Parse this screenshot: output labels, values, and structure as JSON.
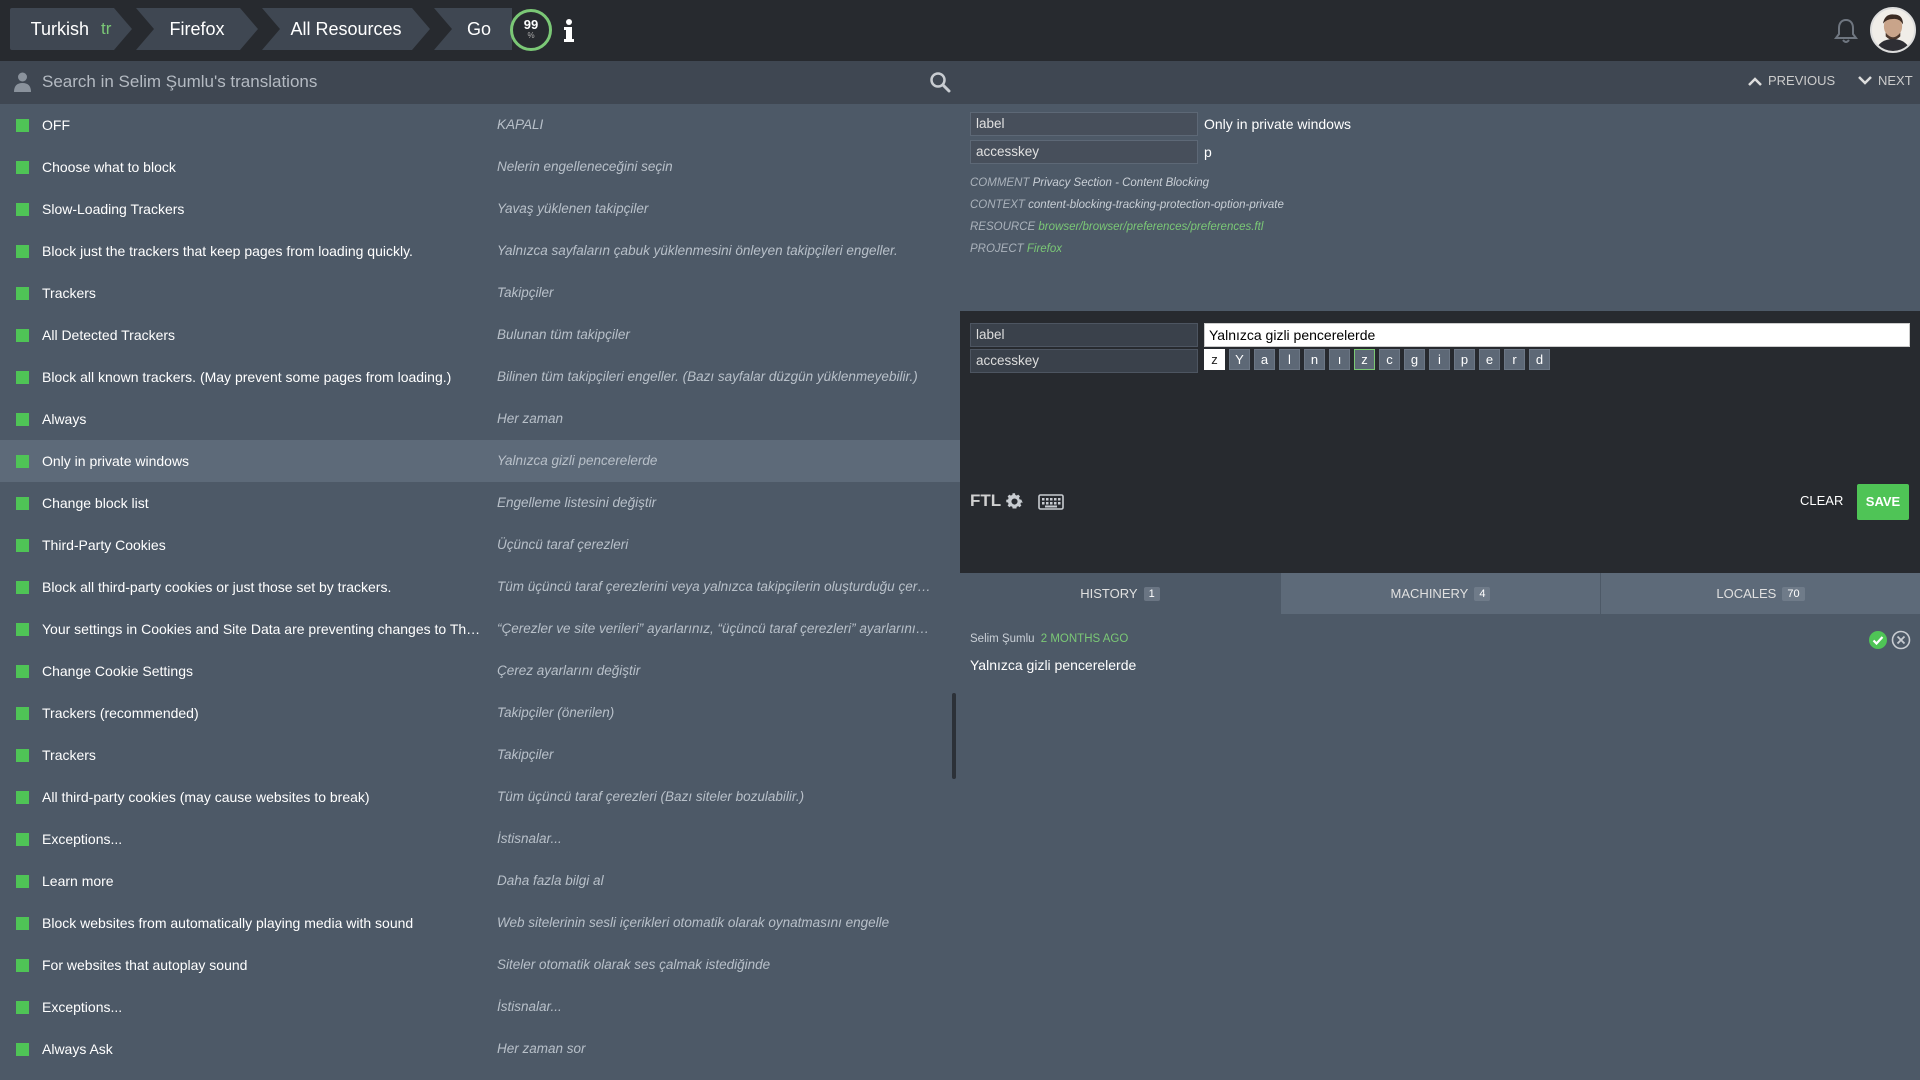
{
  "breadcrumb": {
    "locale_name": "Turkish",
    "locale_code": "tr",
    "project": "Firefox",
    "resource": "All Resources",
    "go": "Go"
  },
  "progress": {
    "value": "99",
    "unit": "%"
  },
  "search": {
    "placeholder": "Search in Selim Şumlu's translations"
  },
  "nav": {
    "previous": "PREVIOUS",
    "next": "NEXT"
  },
  "entities": [
    {
      "source": "OFF",
      "translation": "KAPALI"
    },
    {
      "source": "Choose what to block",
      "translation": "Nelerin engelleneceğini seçin"
    },
    {
      "source": "Slow-Loading Trackers",
      "translation": "Yavaş yüklenen takipçiler"
    },
    {
      "source": "Block just the trackers that keep pages from loading quickly.",
      "translation": "Yalnızca sayfaların çabuk yüklenmesini önleyen takipçileri engeller."
    },
    {
      "source": "Trackers",
      "translation": "Takipçiler"
    },
    {
      "source": "All Detected Trackers",
      "translation": "Bulunan tüm takipçiler"
    },
    {
      "source": "Block all known trackers. (May prevent some pages from loading.)",
      "translation": "Bilinen tüm takipçileri engeller. (Bazı sayfalar düzgün yüklenmeyebilir.)"
    },
    {
      "source": "Always",
      "translation": "Her zaman"
    },
    {
      "source": "Only in private windows",
      "translation": "Yalnızca gizli pencerelerde"
    },
    {
      "source": "Change block list",
      "translation": "Engelleme listesini değiştir"
    },
    {
      "source": "Third-Party Cookies",
      "translation": "Üçüncü taraf çerezleri"
    },
    {
      "source": "Block all third-party cookies or just those set by trackers.",
      "translation": "Tüm üçüncü taraf çerezlerini veya yalnızca takipçilerin oluşturduğu çerezle..."
    },
    {
      "source": "Your settings in Cookies and Site Data are preventing changes to Third...",
      "translation": "“Çerezler ve site verileri” ayarlarınız, “üçüncü taraf çerezleri” ayarlarının de..."
    },
    {
      "source": "Change Cookie Settings",
      "translation": "Çerez ayarlarını değiştir"
    },
    {
      "source": "Trackers (recommended)",
      "translation": "Takipçiler (önerilen)"
    },
    {
      "source": "Trackers",
      "translation": "Takipçiler"
    },
    {
      "source": "All third-party cookies (may cause websites to break)",
      "translation": "Tüm üçüncü taraf çerezleri (Bazı siteler bozulabilir.)"
    },
    {
      "source": "Exceptions...",
      "translation": "İstisnalar..."
    },
    {
      "source": "Learn more",
      "translation": "Daha fazla bilgi al"
    },
    {
      "source": "Block websites from automatically playing media with sound",
      "translation": "Web sitelerinin sesli içerikleri otomatik olarak oynatmasını engelle"
    },
    {
      "source": "For websites that autoplay sound",
      "translation": "Siteler otomatik olarak ses çalmak istediğinde"
    },
    {
      "source": "Exceptions...",
      "translation": "İstisnalar..."
    },
    {
      "source": "Always Ask",
      "translation": "Her zaman sor"
    }
  ],
  "source_panel": {
    "label_key": "label",
    "label_value": "Only in private windows",
    "accesskey_key": "accesskey",
    "accesskey_value": "p",
    "comment_key": "COMMENT",
    "comment_value": "Privacy Section - Content Blocking",
    "context_key": "CONTEXT",
    "context_value": "content-blocking-tracking-protection-option-private",
    "resource_key": "RESOURCE",
    "resource_value": "browser/browser/preferences/preferences.ftl",
    "project_key": "PROJECT",
    "project_value": "Firefox"
  },
  "editor": {
    "label_key": "label",
    "label_value": "Yalnızca gizli pencerelerde",
    "accesskey_key": "accesskey",
    "accesskey_chars": [
      "z",
      "Y",
      "a",
      "l",
      "n",
      "ı",
      "z",
      "c",
      "g",
      "i",
      "p",
      "e",
      "r",
      "d"
    ],
    "ftl": "FTL",
    "clear": "CLEAR",
    "save": "SAVE"
  },
  "tabs": [
    {
      "label": "HISTORY",
      "count": "1"
    },
    {
      "label": "MACHINERY",
      "count": "4"
    },
    {
      "label": "LOCALES",
      "count": "70"
    }
  ],
  "history": {
    "author": "Selim Şumlu",
    "ago": "2 MONTHS AGO",
    "text": "Yalnızca gizli pencerelerde"
  },
  "colors": {
    "accent_green": "#4fc456",
    "topbar": "#272a2f",
    "panel": "#4d5967",
    "active_row": "#5d6a79"
  },
  "icons": [
    "user-icon",
    "search-icon",
    "info-icon",
    "bell-icon",
    "gear-icon",
    "keyboard-icon",
    "approve-icon",
    "reject-icon",
    "chevron-up-icon",
    "chevron-down-icon"
  ]
}
